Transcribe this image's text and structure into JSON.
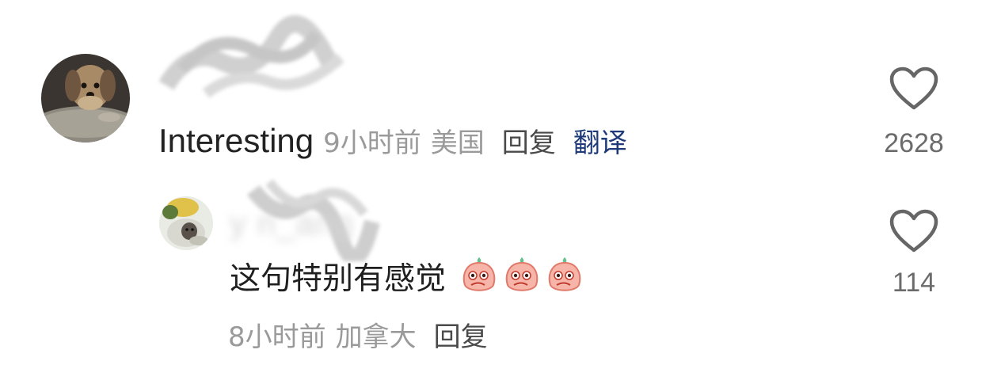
{
  "comments": [
    {
      "avatar": "dog-avatar",
      "username_blurred": "",
      "content": "Interesting",
      "time": "9小时前",
      "region": "美国",
      "reply_label": "回复",
      "translate_label": "翻译",
      "likes": "2628"
    },
    {
      "avatar": "cat-avatar",
      "username_blurred": "y      n_ang",
      "content": "这句特别有感觉",
      "emoji": [
        "peach-covering-mouth-emoji",
        "peach-covering-mouth-emoji",
        "peach-covering-mouth-emoji"
      ],
      "time": "8小时前",
      "region": "加拿大",
      "reply_label": "回复",
      "likes": "114"
    }
  ],
  "colors": {
    "meta_gray": "#9a9a9a",
    "translate_blue": "#1e3a78",
    "icon_gray": "#666666"
  }
}
